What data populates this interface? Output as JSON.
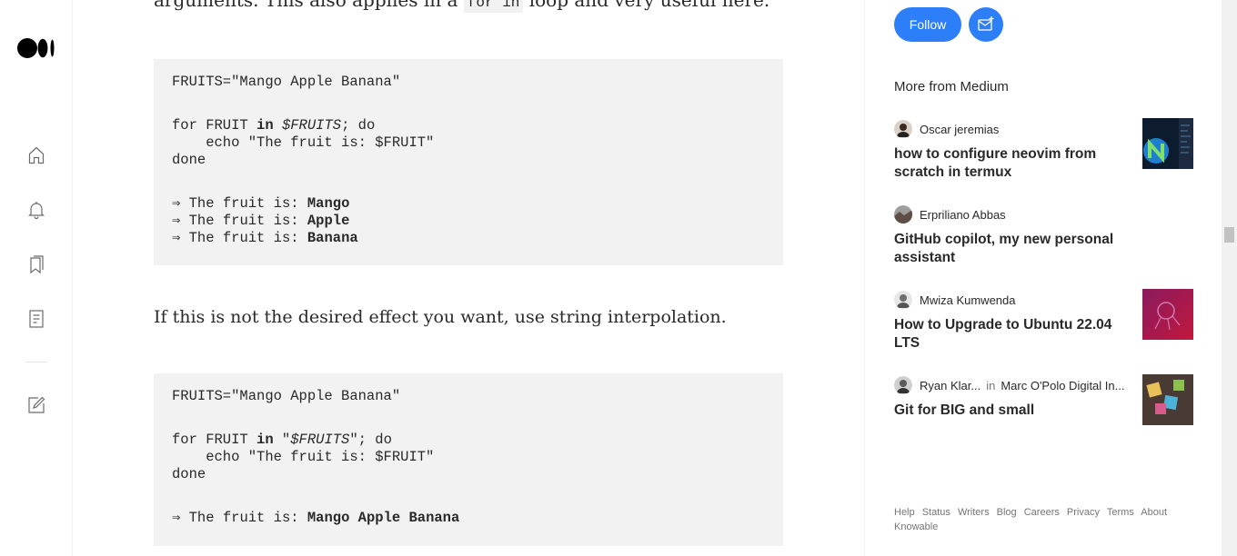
{
  "rail": {
    "items": [
      "home-icon",
      "notifications-icon",
      "lists-icon",
      "stories-icon",
      "write-icon"
    ]
  },
  "article": {
    "cut_line_before": "arguments. This also applies in a ",
    "cut_line_code": "for in",
    "cut_line_after": " loop and very useful here.",
    "code1": {
      "assign": "FRUITS=\"Mango Apple Banana\"",
      "for_pre": "for FRUIT ",
      "for_in": "in",
      "for_var": "$FRUITS",
      "for_post": "; do",
      "echo": "    echo \"The fruit is: $FRUIT\"",
      "done": "done",
      "out_prefix": "⇒ The fruit is: ",
      "outputs": [
        "Mango",
        "Apple",
        "Banana"
      ]
    },
    "prose": "If this is not the desired effect you want, use string interpolation.",
    "code2": {
      "assign": "FRUITS=\"Mango Apple Banana\"",
      "for_pre": "for FRUIT ",
      "for_in": "in",
      "for_q1": " \"",
      "for_var": "$FRUITS",
      "for_post": "\"; do",
      "echo": "    echo \"The fruit is: $FRUIT\"",
      "done": "done",
      "out_prefix": "⇒ The fruit is: ",
      "output": "Mango Apple Banana"
    }
  },
  "side": {
    "follow_label": "Follow",
    "subscribe_icon": "mail-plus-icon",
    "more_title": "More from Medium",
    "items": [
      {
        "author": "Oscar jeremias",
        "publication": "",
        "title": "how to configure neovim from scratch in termux",
        "has_thumb": true
      },
      {
        "author": "Erpriliano Abbas",
        "publication": "",
        "title": "GitHub copilot, my new personal assistant",
        "has_thumb": false
      },
      {
        "author": "Mwiza Kumwenda",
        "publication": "",
        "title": "How to Upgrade to Ubuntu 22.04 LTS",
        "has_thumb": true
      },
      {
        "author": "Ryan Klar...",
        "in_word": "in",
        "publication": "Marc O'Polo Digital In...",
        "title": "Git for BIG and small",
        "has_thumb": true
      }
    ],
    "footer": [
      "Help",
      "Status",
      "Writers",
      "Blog",
      "Careers",
      "Privacy",
      "Terms",
      "About",
      "Knowable"
    ]
  },
  "colors": {
    "accent": "#2d7ff9",
    "code_bg": "#f2f2f2",
    "text": "#292929",
    "muted": "#757575"
  }
}
